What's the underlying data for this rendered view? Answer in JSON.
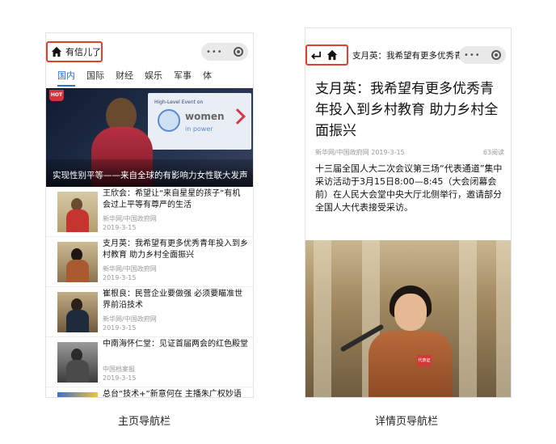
{
  "home_screen": {
    "nav": {
      "title": "有信儿了",
      "capsule_more": "•••"
    },
    "tabs": [
      "国内",
      "国际",
      "财经",
      "娱乐",
      "军事",
      "体"
    ],
    "banner": {
      "hot_badge": "HOT",
      "caption": "实现性别平等——来自全球的有影响力女性联大发声",
      "screen_line": "High-Level Event on",
      "screen_logo": "women",
      "screen_sub": "in power"
    },
    "news": [
      {
        "title": "王欣会：希望让“来自星星的孩子”有机会过上平等有尊严的生活",
        "source": "新华网/中国政府网",
        "date": "2019-3-15"
      },
      {
        "title": "支月英：我希望有更多优秀青年投入到乡村教育 助力乡村全面振兴",
        "source": "新华网/中国政府网",
        "date": "2019-3-15"
      },
      {
        "title": "崔根良：民营企业要做强 必须要瞄准世界前沿技术",
        "source": "新华网/中国政府网",
        "date": "2019-3-15"
      },
      {
        "title": "中南海怀仁堂：见证首届两会的红色殿堂",
        "source": "中国档案报",
        "date": "2019-3-15"
      },
      {
        "title": "总台“技术+”新意何在 主播朱广权妙语"
      }
    ],
    "caption": "主页导航栏"
  },
  "detail_screen": {
    "nav": {
      "title": "支月英：我希望有更多优秀青...",
      "capsule_more": "•••"
    },
    "article": {
      "title": "支月英：我希望有更多优秀青年投入到乡村教育 助力乡村全面振兴",
      "source": "新华网/中国政府网 2019-3-15",
      "reads": "63阅读",
      "body": "十三届全国人大二次会议第三场“代表通道”集中采访活动于3月15日8:00—8:45（大会闭幕会前）在人民大会堂中央大厅北侧举行，邀请部分全国人大代表接受采访。",
      "photo_badge": "代表证"
    },
    "caption": "详情页导航栏"
  },
  "colors": {
    "highlight_border": "#e0412d",
    "active_tab": "#2d6be0",
    "capsule_bg": "#e9e9e9"
  },
  "icons": [
    "home-icon",
    "back-icon",
    "more-dots-icon",
    "close-target-icon"
  ]
}
